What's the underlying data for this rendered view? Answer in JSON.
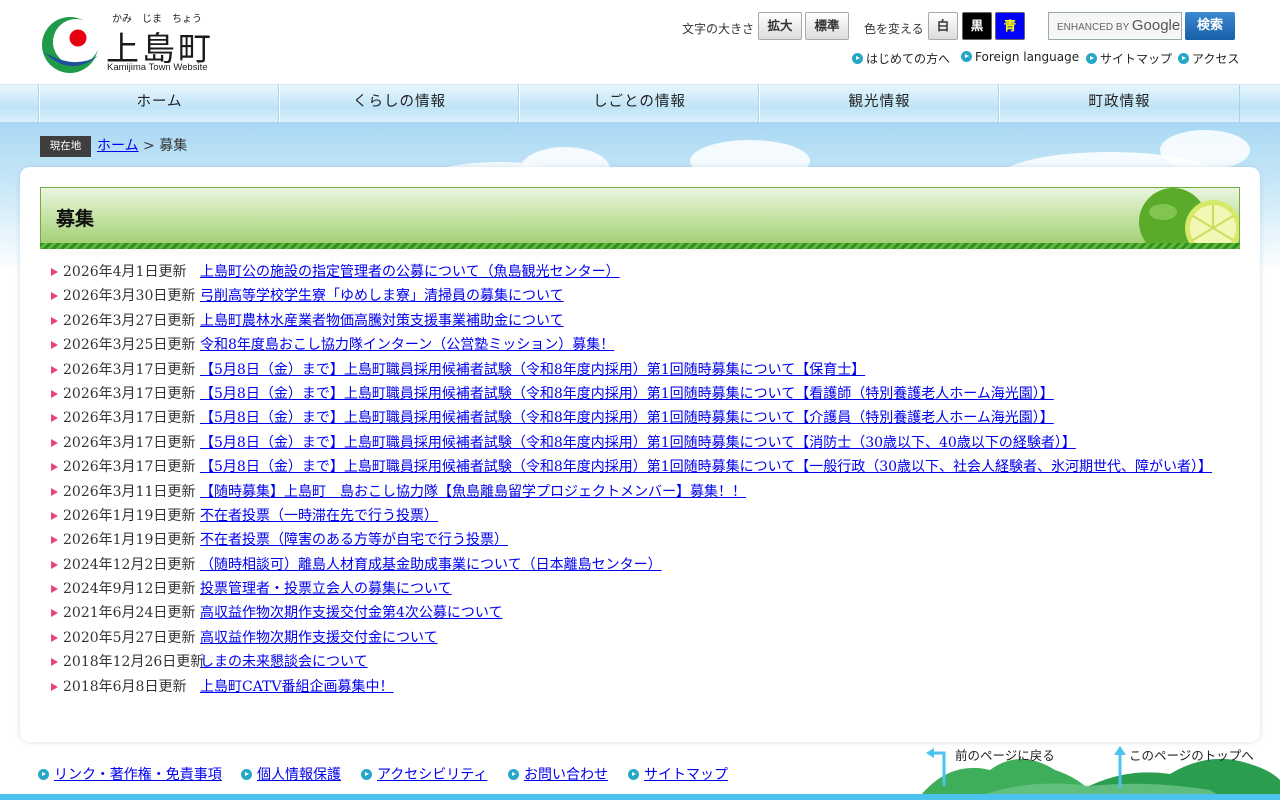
{
  "logo": {
    "ruby": "かみ　じま　ちょう",
    "name": "上島町",
    "subtitle": "Kamijima Town Website"
  },
  "tools": {
    "font_size_label": "文字の大きさ",
    "enlarge": "拡大",
    "standard": "標準",
    "color_label": "色を変える",
    "white": "白",
    "black": "黒",
    "blue": "青",
    "search_enhanced": "ENHANCED BY",
    "search_google": "Google",
    "search_button": "検索"
  },
  "sublinks": [
    "はじめての方へ",
    "Foreign language",
    "サイトマップ",
    "アクセス"
  ],
  "nav": [
    "ホーム",
    "くらしの情報",
    "しごとの情報",
    "観光情報",
    "町政情報"
  ],
  "breadcrumb": {
    "badge": "現在地",
    "home": "ホーム",
    "separator": ">",
    "current": "募集"
  },
  "page_title": "募集",
  "news": [
    {
      "date": "2026年4月1日更新",
      "title": "上島町公の施設の指定管理者の公募について（魚島観光センター）"
    },
    {
      "date": "2026年3月30日更新",
      "title": "弓削高等学校学生寮「ゆめしま寮」清掃員の募集について"
    },
    {
      "date": "2026年3月27日更新",
      "title": "上島町農林水産業者物価高騰対策支援事業補助金について"
    },
    {
      "date": "2026年3月25日更新",
      "title": "令和8年度島おこし協力隊インターン（公営塾ミッション）募集！"
    },
    {
      "date": "2026年3月17日更新",
      "title": "【5月8日（金）まで】上島町職員採用候補者試験（令和8年度内採用）第1回随時募集について【保育士】"
    },
    {
      "date": "2026年3月17日更新",
      "title": "【5月8日（金）まで】上島町職員採用候補者試験（令和8年度内採用）第1回随時募集について【看護師（特別養護老人ホーム海光園）】"
    },
    {
      "date": "2026年3月17日更新",
      "title": "【5月8日（金）まで】上島町職員採用候補者試験（令和8年度内採用）第1回随時募集について【介護員（特別養護老人ホーム海光園）】"
    },
    {
      "date": "2026年3月17日更新",
      "title": "【5月8日（金）まで】上島町職員採用候補者試験（令和8年度内採用）第1回随時募集について【消防士（30歳以下、40歳以下の経験者）】"
    },
    {
      "date": "2026年3月17日更新",
      "title": "【5月8日（金）まで】上島町職員採用候補者試験（令和8年度内採用）第1回随時募集について【一般行政（30歳以下、社会人経験者、氷河期世代、障がい者）】"
    },
    {
      "date": "2026年3月11日更新",
      "title": "【随時募集】上島町　島おこし協力隊【魚島離島留学プロジェクトメンバー】募集！！"
    },
    {
      "date": "2026年1月19日更新",
      "title": "不在者投票（一時滞在先で行う投票）"
    },
    {
      "date": "2026年1月19日更新",
      "title": "不在者投票（障害のある方等が自宅で行う投票）"
    },
    {
      "date": "2024年12月2日更新",
      "title": "（随時相談可）離島人材育成基金助成事業について（日本離島センター）"
    },
    {
      "date": "2024年9月12日更新",
      "title": "投票管理者・投票立会人の募集について"
    },
    {
      "date": "2021年6月24日更新",
      "title": "高収益作物次期作支援交付金第4次公募について"
    },
    {
      "date": "2020年5月27日更新",
      "title": "高収益作物次期作支援交付金について"
    },
    {
      "date": "2018年12月26日更新",
      "title": "しまの未来懇談会について"
    },
    {
      "date": "2018年6月8日更新",
      "title": "上島町CATV番組企画募集中！"
    }
  ],
  "footer_links": [
    "リンク・著作権・免責事項",
    "個人情報保護",
    "アクセシビリティ",
    "お問い合わせ",
    "サイトマップ"
  ],
  "page_nav": {
    "back": "前のページに戻る",
    "top": "このページのトップへ"
  },
  "colors": {
    "link": "#0000ee",
    "nav_bg": "#bfe4f7",
    "title_bar_green": "#9ccc6d",
    "list_arrow": "#e8457c",
    "footer_bar": "#4cc3ee"
  }
}
